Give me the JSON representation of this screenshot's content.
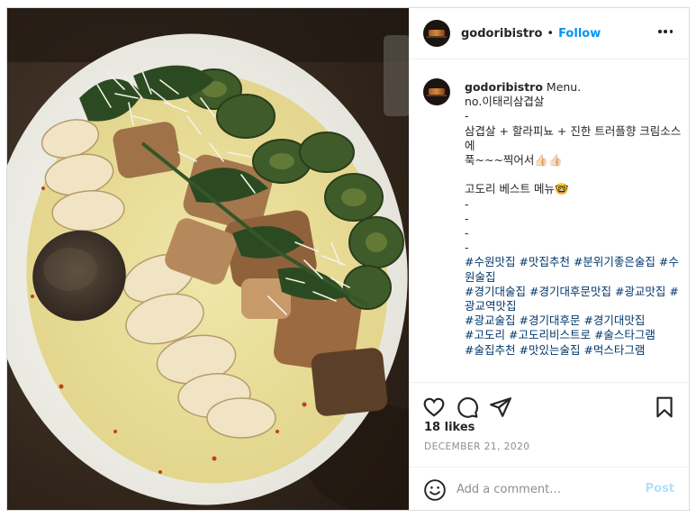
{
  "post": {
    "username": "godoribistro",
    "separator": "•",
    "follow_label": "Follow",
    "more_icon": "more-horizontal-icon",
    "image_alt": "Plate of Italian pork belly with jalapeños, mushrooms, potato slices and truffle cream sauce topped with grated cheese"
  },
  "caption": {
    "username": "godoribistro",
    "lines": [
      "Menu.",
      "no.이태리삼겹살",
      "-",
      "삼겹살 + 할라피뇨 + 진한 트러플향 크림소스",
      "에",
      "푹~~~찍어서👍🏻👍🏻",
      "",
      "고도리 베스트 메뉴🤓",
      "-",
      "-",
      "-",
      "-"
    ],
    "hashtag_lines": [
      [
        "#수원맛집",
        "#맛집추천",
        "#분위기좋은술집",
        "#수"
      ],
      [
        "원술집"
      ],
      [
        "#경기대술집",
        "#경기대후문맛집",
        "#광교맛집",
        "#"
      ],
      [
        "광교역맛집"
      ],
      [
        "#광교술집",
        "#경기대후문",
        "#경기대맛집"
      ],
      [
        "#고도리",
        "#고도리비스트로",
        "#술스타그램"
      ],
      [
        "#술집추천",
        "#맛있는술집",
        "#먹스타그램"
      ]
    ]
  },
  "actions": {
    "like_icon": "heart-icon",
    "comment_icon": "comment-icon",
    "share_icon": "paper-plane-icon",
    "save_icon": "bookmark-icon"
  },
  "likes_text": "18 likes",
  "date_text": "DECEMBER 21, 2020",
  "comment_box": {
    "emoji_icon": "smiley-icon",
    "placeholder": "Add a comment…",
    "post_label": "Post"
  },
  "colors": {
    "accent": "#0095f6",
    "hashtag": "#00376b",
    "post_disabled": "#b2dffc",
    "muted": "#8e8e8e"
  }
}
